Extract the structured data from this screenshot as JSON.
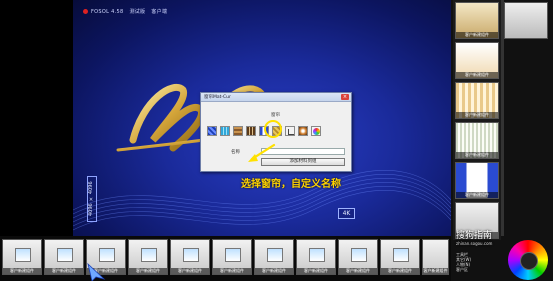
{
  "app": {
    "version_label": "FOSOL 4.58",
    "edition_label": "测试版",
    "client_label": "客户端"
  },
  "viewport": {
    "side_label": "4096 × 4096",
    "badge": "4K",
    "caption": "选择窗帘，自定义名称"
  },
  "dialog": {
    "title": "窗帘Mat-Cur",
    "close_label": "×",
    "group_label": "窗帘",
    "name_label": "名称",
    "name_value": "",
    "add_button_label": "添加材料到组",
    "material_tiles": [
      "pattern-blue-icon",
      "tile-cyan-icon",
      "wood-panel-icon",
      "curtain-wood-icon",
      "curtain-blue-icon",
      "gold-pattern-icon",
      "chair-icon",
      "lamp-glow-icon",
      "color-ball-icon"
    ]
  },
  "right_panel": {
    "thumbnails": [
      {
        "label": "客户新建组件"
      },
      {
        "label": "客户新建组件"
      },
      {
        "label": "客户新建组件"
      },
      {
        "label": "客户新建组件"
      },
      {
        "label": "客户新建组件"
      },
      {
        "label": "客户新建组件"
      }
    ],
    "watermark": "搜狗指南",
    "watermark_url": "zhinan.sogou.com",
    "side_list": [
      "工具栏",
      "其它(W)",
      "人物(N)",
      "客户区"
    ]
  },
  "bottom_strip": {
    "thumbnails": [
      {
        "label": "客户新建组件"
      },
      {
        "label": "客户新建组件"
      },
      {
        "label": "客户新建组件"
      },
      {
        "label": "客户新建组件"
      },
      {
        "label": "客户新建组件"
      },
      {
        "label": "客户新建组件"
      },
      {
        "label": "客户新建组件"
      },
      {
        "label": "客户新建组件"
      },
      {
        "label": "客户新建组件"
      },
      {
        "label": "客户新建组件"
      },
      {
        "label": "客户新建组件"
      }
    ]
  },
  "colors": {
    "viewport_bg": "#1a2a9a",
    "caption": "#ffd400",
    "highlight_ring": "#ffe100",
    "arrow": "#ffe100",
    "gold_logo": "#d4a53a"
  }
}
